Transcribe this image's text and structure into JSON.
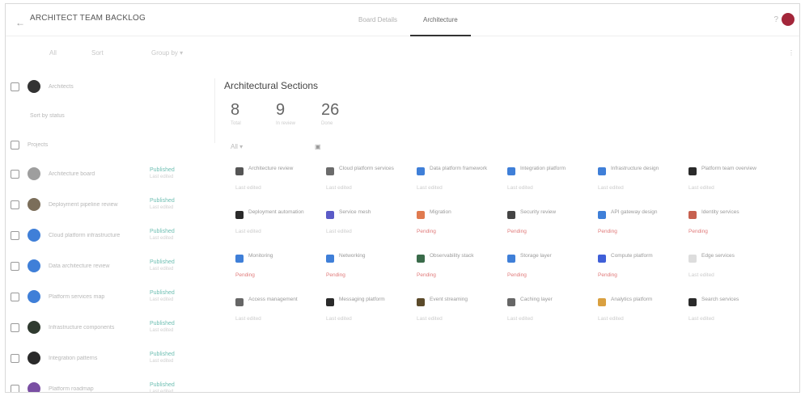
{
  "header": {
    "title": "ARCHITECT TEAM BACKLOG",
    "tabs": [
      {
        "label": "Board Details"
      },
      {
        "label": "Architecture"
      }
    ],
    "help_label": "?"
  },
  "toolbar": {
    "items": [
      "All",
      "Sort",
      "Group by ▾"
    ],
    "right_label": "⋮"
  },
  "left_panel": {
    "owner": {
      "label": "Architects"
    },
    "sub_label": "Sort by status",
    "section_label": "Projects",
    "rows": [
      {
        "name": "Architecture board",
        "status": "Published",
        "sub": "Last edited",
        "icon_color": "#9e9e9e"
      },
      {
        "name": "Deployment pipeline review",
        "status": "Published",
        "sub": "Last edited",
        "icon_color": "#7b6e5a"
      },
      {
        "name": "Cloud platform infrastructure",
        "status": "Published",
        "sub": "Last edited",
        "icon_color": "#3f7fd8"
      },
      {
        "name": "Data architecture review",
        "status": "Published",
        "sub": "Last edited",
        "icon_color": "#3f7fd8"
      },
      {
        "name": "Platform services map",
        "status": "Published",
        "sub": "Last edited",
        "icon_color": "#3f7fd8"
      },
      {
        "name": "Infrastructure components",
        "status": "Published",
        "sub": "Last edited",
        "icon_color": "#2f3a2f"
      },
      {
        "name": "Integration patterns",
        "status": "Published",
        "sub": "Last edited",
        "icon_color": "#2a2a2a"
      },
      {
        "name": "Platform roadmap",
        "status": "Published",
        "sub": "Last edited",
        "icon_color": "#7a4fa3"
      }
    ]
  },
  "main": {
    "heading": "Architectural Sections",
    "stats": [
      {
        "value": "8",
        "label": "Total"
      },
      {
        "value": "9",
        "label": "In review"
      },
      {
        "value": "26",
        "label": "Done"
      }
    ],
    "filter_label": "All ▾",
    "cards": [
      {
        "title": "Architecture review",
        "sub": "Last edited",
        "color": "#555",
        "red": false
      },
      {
        "title": "Cloud platform services",
        "sub": "Last edited",
        "color": "#6b6b6b",
        "red": false
      },
      {
        "title": "Data platform framework",
        "sub": "Last edited",
        "color": "#3f7fd8",
        "red": false
      },
      {
        "title": "Integration platform",
        "sub": "Last edited",
        "color": "#3f7fd8",
        "red": false
      },
      {
        "title": "Infrastructure design",
        "sub": "Last edited",
        "color": "#3f7fd8",
        "red": false
      },
      {
        "title": "Platform team overview",
        "sub": "Last edited",
        "color": "#2a2a2a",
        "red": false
      },
      {
        "title": "Deployment automation",
        "sub": "Last edited",
        "color": "#2a2a2a",
        "red": false
      },
      {
        "title": "Service mesh",
        "sub": "Last edited",
        "color": "#5b5bc7",
        "red": false
      },
      {
        "title": "Migration",
        "sub": "Pending",
        "color": "#e07a4f",
        "red": true
      },
      {
        "title": "Security review",
        "sub": "Pending",
        "color": "#444",
        "red": true
      },
      {
        "title": "API gateway design",
        "sub": "Pending",
        "color": "#3f7fd8",
        "red": true
      },
      {
        "title": "Identity services",
        "sub": "Pending",
        "color": "#c7604f",
        "red": true
      },
      {
        "title": "Monitoring",
        "sub": "Pending",
        "color": "#3f7fd8",
        "red": true
      },
      {
        "title": "Networking",
        "sub": "Pending",
        "color": "#3f7fd8",
        "red": true
      },
      {
        "title": "Observability stack",
        "sub": "Pending",
        "color": "#3a6b4a",
        "red": true
      },
      {
        "title": "Storage layer",
        "sub": "Pending",
        "color": "#3f7fd8",
        "red": true
      },
      {
        "title": "Compute platform",
        "sub": "Pending",
        "color": "#3f5fd8",
        "red": true
      },
      {
        "title": "Edge services",
        "sub": "Last edited",
        "color": "#ddd",
        "red": false
      },
      {
        "title": "Access management",
        "sub": "Last edited",
        "color": "#666",
        "red": false
      },
      {
        "title": "Messaging platform",
        "sub": "Last edited",
        "color": "#2a2a2a",
        "red": false
      },
      {
        "title": "Event streaming",
        "sub": "Last edited",
        "color": "#5b4a2a",
        "red": false
      },
      {
        "title": "Caching layer",
        "sub": "Last edited",
        "color": "#666",
        "red": false
      },
      {
        "title": "Analytics platform",
        "sub": "Last edited",
        "color": "#d9a040",
        "red": false
      },
      {
        "title": "Search services",
        "sub": "Last edited",
        "color": "#2a2a2a",
        "red": false
      }
    ]
  }
}
